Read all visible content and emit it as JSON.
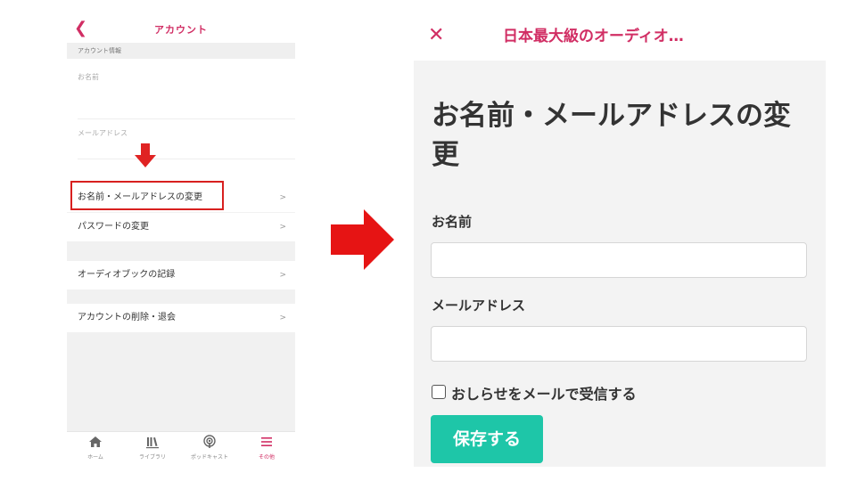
{
  "left_screen": {
    "back_icon": "chevron-left-icon",
    "title": "アカウント",
    "section_header": "アカウント情報",
    "name_label": "お名前",
    "email_label": "メールアドレス",
    "menu": [
      {
        "label": "お名前・メールアドレスの変更",
        "chevron": ">"
      },
      {
        "label": "パスワードの変更",
        "chevron": ">"
      },
      {
        "label": "オーディオブックの記録",
        "chevron": ">"
      },
      {
        "label": "アカウントの削除・退会",
        "chevron": ">"
      }
    ],
    "tabs": [
      {
        "label": "ホーム",
        "icon": "home-icon"
      },
      {
        "label": "ライブラリ",
        "icon": "library-icon"
      },
      {
        "label": "ポッドキャスト",
        "icon": "podcast-icon"
      },
      {
        "label": "その他",
        "icon": "menu-icon"
      }
    ],
    "accent_color": "#d12e64",
    "highlight_color": "#d8201f"
  },
  "right_screen": {
    "close_icon": "close-icon",
    "header_title": "日本最大級のオーディオ…",
    "page_title": "お名前・メールアドレスの変更",
    "name_label": "お名前",
    "name_value": "",
    "email_label": "メールアドレス",
    "email_value": "",
    "newsletter_label": "おしらせをメールで受信する",
    "newsletter_checked": false,
    "save_label": "保存する",
    "save_color": "#1ec6a8"
  },
  "arrow_icon": "arrow-right-icon"
}
